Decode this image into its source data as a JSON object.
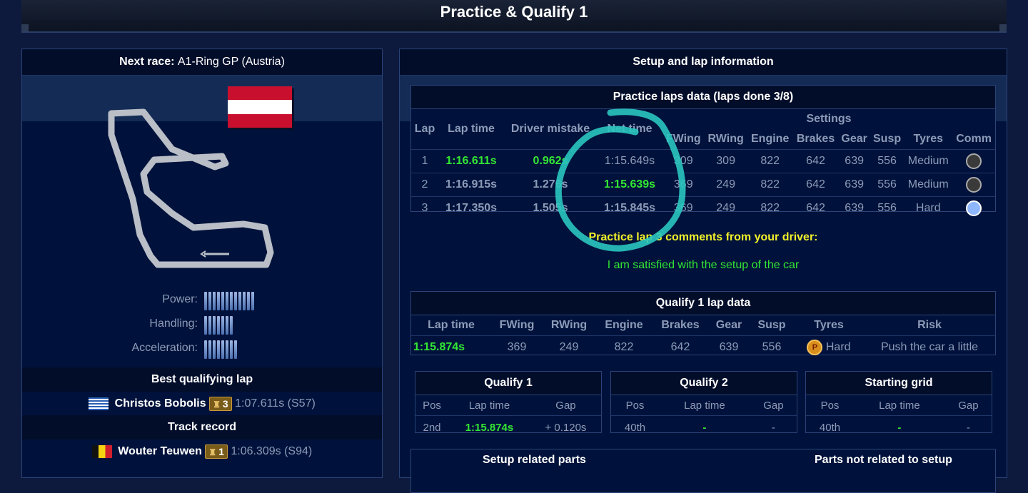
{
  "header": {
    "title": "Practice & Qualify 1"
  },
  "race_panel": {
    "next_race_label": "Next race:",
    "next_race_value": "A1-Ring GP (Austria)",
    "power_label": "Power:",
    "power_level": 12,
    "handling_label": "Handling:",
    "handling_level": 7,
    "acceleration_label": "Acceleration:",
    "acceleration_level": 8,
    "best_qualifying_title": "Best qualifying lap",
    "best_qualifying": {
      "driver": "Christos Bobolis",
      "trophies": "3",
      "time": "1:07.611s",
      "season": "(S57)"
    },
    "track_record_title": "Track record",
    "track_record": {
      "driver": "Wouter Teuwen",
      "trophies": "1",
      "time": "1:06.309s",
      "season": "(S94)"
    }
  },
  "setup_panel": {
    "title": "Setup and lap information",
    "practice_title": "Practice laps data (laps done 3/8)",
    "settings_label": "Settings",
    "practice_headers": [
      "Lap",
      "Lap time",
      "Driver mistake",
      "Net time",
      "FWing",
      "RWing",
      "Engine",
      "Brakes",
      "Gear",
      "Susp",
      "Tyres",
      "Comm"
    ],
    "practice_rows": [
      {
        "lap": "1",
        "lap_time": "1:16.611s",
        "mistake": "0.962s",
        "net": "1:15.649s",
        "fwing": "309",
        "rwing": "309",
        "engine": "822",
        "brakes": "642",
        "gear": "639",
        "susp": "556",
        "tyres": "Medium"
      },
      {
        "lap": "2",
        "lap_time": "1:16.915s",
        "mistake": "1.276s",
        "net": "1:15.639s",
        "fwing": "369",
        "rwing": "249",
        "engine": "822",
        "brakes": "642",
        "gear": "639",
        "susp": "556",
        "tyres": "Medium"
      },
      {
        "lap": "3",
        "lap_time": "1:17.350s",
        "mistake": "1.505s",
        "net": "1:15.845s",
        "fwing": "369",
        "rwing": "249",
        "engine": "822",
        "brakes": "642",
        "gear": "639",
        "susp": "556",
        "tyres": "Hard"
      }
    ],
    "comment_title": "Practice lap 3 comments from your driver:",
    "comment_text": "I am satisfied with the setup of the car",
    "q1_lap_title": "Qualify 1 lap data",
    "q1_headers": [
      "Lap time",
      "FWing",
      "RWing",
      "Engine",
      "Brakes",
      "Gear",
      "Susp",
      "Tyres",
      "Risk"
    ],
    "q1_row": {
      "lap_time": "1:15.874s",
      "fwing": "369",
      "rwing": "249",
      "engine": "822",
      "brakes": "642",
      "gear": "639",
      "susp": "556",
      "tyre_icon": "P",
      "tyres": "Hard",
      "risk": "Push the car a little"
    },
    "result_headers": [
      "Pos",
      "Lap time",
      "Gap"
    ],
    "qualify1": {
      "title": "Qualify 1",
      "pos": "2nd",
      "lap_time": "1:15.874s",
      "gap": "+ 0.120s"
    },
    "qualify2": {
      "title": "Qualify 2",
      "pos": "40th",
      "lap_time": "-",
      "gap": "-"
    },
    "starting_grid": {
      "title": "Starting grid",
      "pos": "40th",
      "lap_time": "-",
      "gap": "-"
    },
    "bottom_left_title": "Setup related parts",
    "bottom_right_title": "Parts not related to setup"
  },
  "colors": {
    "accent_green": "#33e633",
    "comment_yellow": "#f0f02a",
    "annotation_teal": "#2ac7c0"
  }
}
